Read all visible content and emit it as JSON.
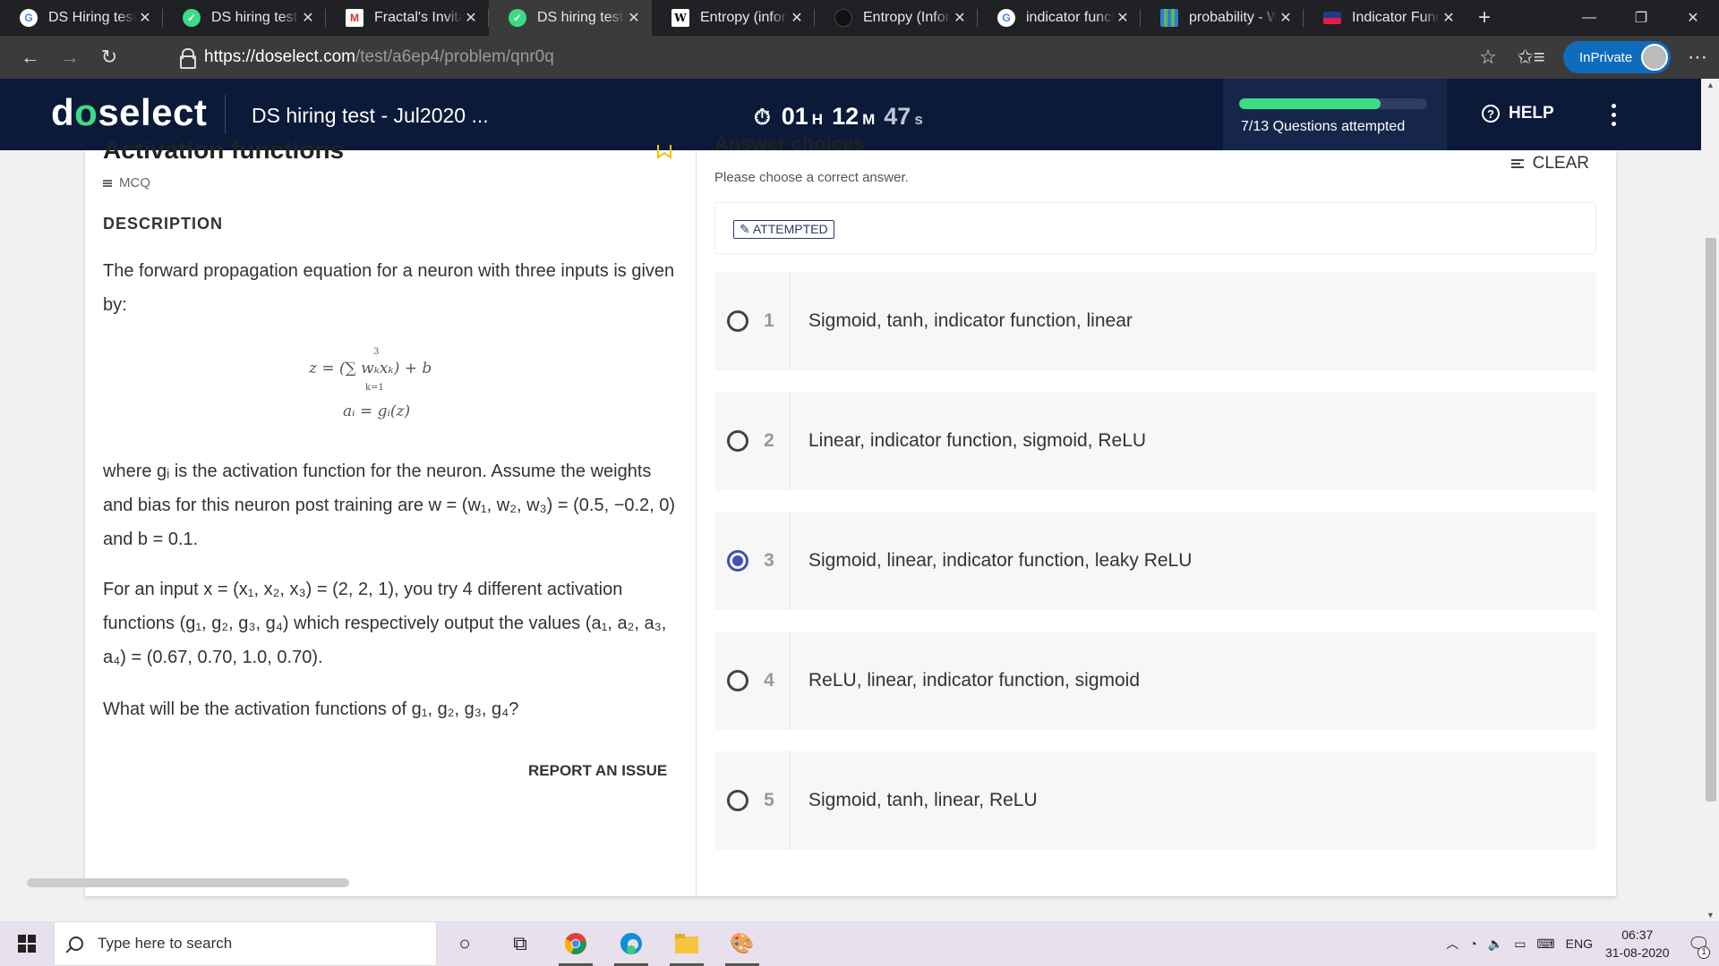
{
  "browser": {
    "tabs": [
      {
        "title": "DS Hiring test",
        "favicon": "google-icon",
        "active": false
      },
      {
        "title": "DS hiring test -",
        "favicon": "check-icon",
        "active": false
      },
      {
        "title": "Fractal's Invitat",
        "favicon": "gmail-icon",
        "active": false
      },
      {
        "title": "DS hiring test -",
        "favicon": "check-icon",
        "active": true
      },
      {
        "title": "Entropy (inform",
        "favicon": "wikipedia-icon",
        "active": false
      },
      {
        "title": "Entropy (Inform",
        "favicon": "dark-site-icon",
        "active": false
      },
      {
        "title": "indicator functi",
        "favicon": "google-icon",
        "active": false
      },
      {
        "title": "probability - W",
        "favicon": "grid-icon",
        "active": false
      },
      {
        "title": "Indicator Functi",
        "favicon": "slide-icon",
        "active": false
      }
    ],
    "url_host": "https://doselect.com",
    "url_path": "/test/a6ep4/problem/qnr0q",
    "inprivate_label": "InPrivate"
  },
  "header": {
    "logo_pre": "d",
    "logo_mid": "o",
    "logo_post": "select",
    "test_name": "DS hiring test - Jul2020 ...",
    "timer": {
      "hours": "01",
      "h_unit": "H",
      "minutes": "12",
      "m_unit": "M",
      "seconds": "47",
      "s_unit": "s"
    },
    "progress_fraction": 0.75,
    "progress_text": "7/13 Questions attempted",
    "help_label": "HELP"
  },
  "question": {
    "title": "Activation functions",
    "type": "MCQ",
    "description_heading": "DESCRIPTION",
    "p1": "The forward propagation equation for a neuron with three inputs is given by:",
    "formula_line1": "z = (∑ wₖxₖ) + b",
    "formula_sum_top": "3",
    "formula_sum_bottom": "k=1",
    "formula_line2": "aᵢ = gᵢ(z)",
    "p2": "where gᵢ is the activation function for the neuron. Assume the weights and bias for this neuron post training are w = (w₁, w₂, w₃) = (0.5, −0.2, 0) and b = 0.1.",
    "p3": "For an input x = (x₁, x₂, x₃) = (2, 2, 1), you try 4 different activation functions (g₁, g₂, g₃, g₄) which respectively output the values (a₁, a₂, a₃, a₄) = (0.67, 0.70, 1.0, 0.70).",
    "p4": "What will be the activation functions of g₁, g₂, g₃, g₄?",
    "report_label": "REPORT AN ISSUE"
  },
  "answers": {
    "heading": "Answer choices",
    "instruction": "Please choose a correct answer.",
    "clear_label": "CLEAR",
    "status_badge": "ATTEMPTED",
    "options": [
      {
        "num": "1",
        "text": "Sigmoid, tanh, indicator function, linear",
        "selected": false
      },
      {
        "num": "2",
        "text": "Linear, indicator function, sigmoid, ReLU",
        "selected": false
      },
      {
        "num": "3",
        "text": "Sigmoid, linear, indicator function, leaky ReLU",
        "selected": true
      },
      {
        "num": "4",
        "text": "ReLU, linear, indicator function, sigmoid",
        "selected": false
      },
      {
        "num": "5",
        "text": "Sigmoid, tanh, linear, ReLU",
        "selected": false
      }
    ]
  },
  "taskbar": {
    "search_placeholder": "Type here to search",
    "lang": "ENG",
    "time": "06:37",
    "date": "31-08-2020",
    "notifications": "1"
  },
  "colors": {
    "header_bg": "#0b1a38",
    "accent_green": "#3ddc84",
    "radio_selected": "#3f51b5",
    "edge_blue": "#0f6cbd"
  }
}
